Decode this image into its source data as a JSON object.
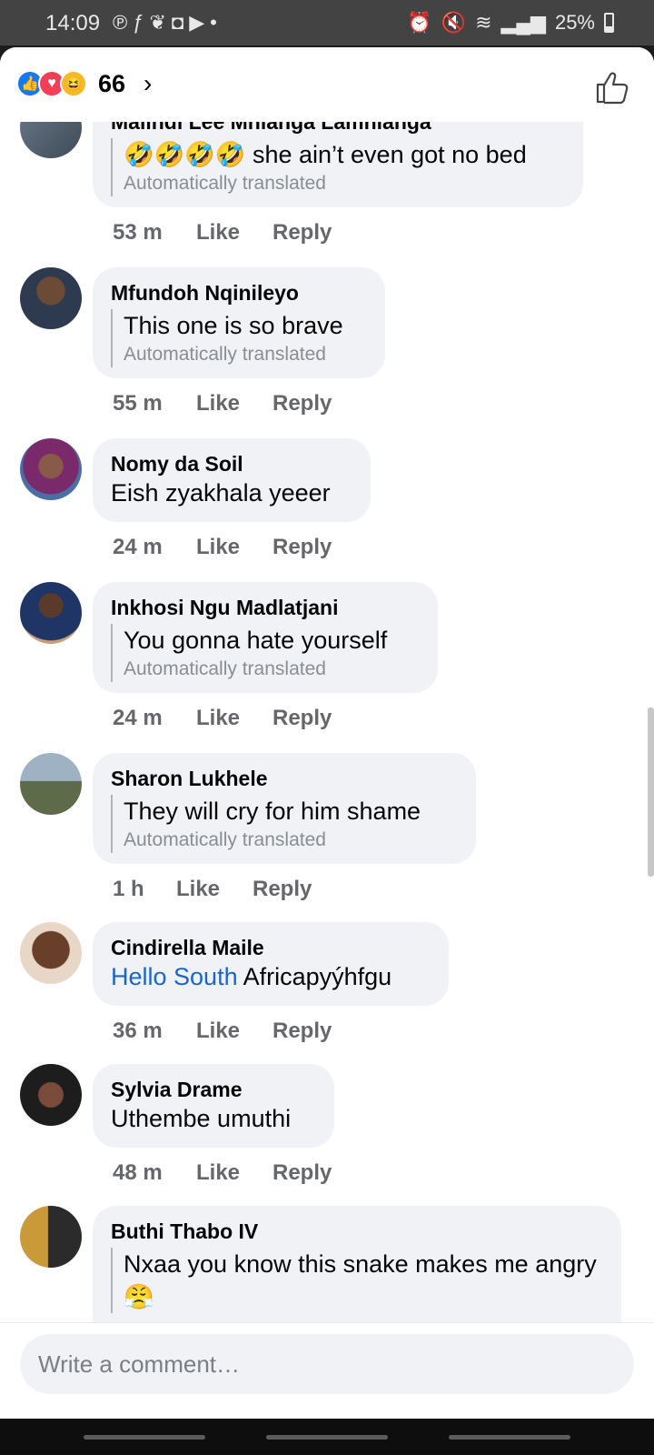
{
  "status_bar": {
    "time": "14:09",
    "left_icons": [
      "pinterest-icon",
      "fitness-icon",
      "twitter-icon",
      "media-icon",
      "youtube-icon",
      "dot-icon"
    ],
    "battery": "25%"
  },
  "header": {
    "reaction_icons": [
      "like",
      "love",
      "haha"
    ],
    "reaction_count": "66",
    "chevron": "›"
  },
  "comments": [
    {
      "author": "Malindi Lee Mhlanga Lamhlanga",
      "text": "🤣🤣🤣🤣 she ain’t even got no bed",
      "translated_label": "Automatically translated",
      "time": "53 m",
      "like": "Like",
      "reply": "Reply"
    },
    {
      "author": "Mfundoh Nqinileyo",
      "text": "This one is so brave",
      "translated_label": "Automatically translated",
      "time": "55 m",
      "like": "Like",
      "reply": "Reply"
    },
    {
      "author": "Nomy da Soil",
      "text": "Eish zyakhala yeeer",
      "time": "24 m",
      "like": "Like",
      "reply": "Reply"
    },
    {
      "author": "Inkhosi Ngu Madlatjani",
      "text": "You gonna hate yourself",
      "translated_label": "Automatically translated",
      "time": "24 m",
      "like": "Like",
      "reply": "Reply"
    },
    {
      "author": "Sharon Lukhele",
      "text": "They will cry for him shame",
      "translated_label": "Automatically translated",
      "time": "1 h",
      "like": "Like",
      "reply": "Reply"
    },
    {
      "author": "Cindirella Maile",
      "link_text": "Hello South",
      "text": " Africapyýhfgu",
      "time": "36 m",
      "like": "Like",
      "reply": "Reply"
    },
    {
      "author": "Sylvia Drame",
      "text": "Uthembe umuthi",
      "time": "48 m",
      "like": "Like",
      "reply": "Reply"
    },
    {
      "author": "Buthi Thabo IV",
      "text": "Nxaa you know this snake makes me angry😤"
    }
  ],
  "composer": {
    "placeholder": "Write a comment…"
  }
}
